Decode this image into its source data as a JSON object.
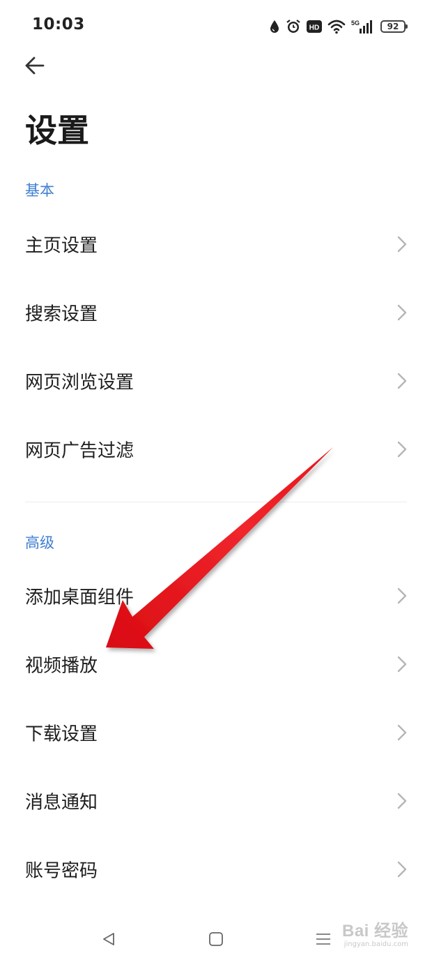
{
  "status_bar": {
    "time": "10:03",
    "icons": [
      "water-drop-icon",
      "alarm-icon",
      "hd-icon",
      "wifi-icon",
      "5g-signal-icon"
    ],
    "network": "5G",
    "hd_label": "HD",
    "battery_level": "92"
  },
  "header": {
    "back_icon": "arrow-left-icon",
    "title": "设置"
  },
  "sections": {
    "basic": {
      "title": "基本",
      "items": [
        {
          "label": "主页设置"
        },
        {
          "label": "搜索设置"
        },
        {
          "label": "网页浏览设置"
        },
        {
          "label": "网页广告过滤"
        }
      ]
    },
    "advanced": {
      "title": "高级",
      "items": [
        {
          "label": "添加桌面组件"
        },
        {
          "label": "视频播放"
        },
        {
          "label": "下载设置"
        },
        {
          "label": "消息通知"
        },
        {
          "label": "账号密码"
        }
      ]
    }
  },
  "annotation": {
    "arrow_color": "#e8151b",
    "points_to": "视频播放"
  },
  "nav_bar": {
    "icons": [
      "back-triangle-icon",
      "home-square-icon",
      "menu-lines-icon"
    ]
  },
  "watermark": {
    "main": "Bai 经验",
    "sub": "jingyan.baidu.com"
  },
  "colors": {
    "accent": "#3f7fd0",
    "text": "#1d1d1d",
    "chevron": "#b5b5b5"
  }
}
